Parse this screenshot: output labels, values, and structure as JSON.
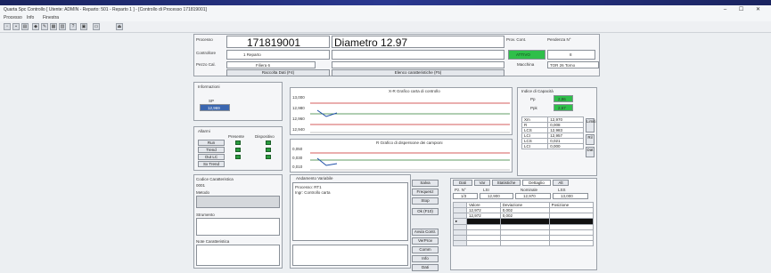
{
  "window": {
    "title": "Quarta Spc Controllo [ Utente: ADMIN - Reparto: 501 - Reparto 1 ] - [Controllo di Processo 171819001]",
    "controls": "– ☐ ✕"
  },
  "menu": [
    "Processo",
    "Info",
    "Finestra"
  ],
  "header": {
    "process_label": "Processo",
    "process_value": "171819001",
    "diameter": "Diametro 12.97",
    "controller_label": "Controllore",
    "controller_value": "1 Reparto",
    "part_label": "Pezzo Cal.",
    "part_value": "Filiera 6",
    "prov_label": "Prov. Cont.",
    "pending_label": "Pendenza N°",
    "pending_value": "8",
    "status_value": "ATTIVO",
    "machine_label": "Macchina",
    "machine_value": "TOR 26 Torno",
    "buttons": {
      "collect": "Raccolta Dati (F4)",
      "list": "Elenco caratteristiche (F5)"
    }
  },
  "info": {
    "title": "Informazioni",
    "sp_label": "SP",
    "sp_value": "12,969"
  },
  "alarms": {
    "title": "Allarmi",
    "col1": "Presente",
    "col2": "Dispositivo",
    "rows": [
      "Run",
      "Trend",
      "Out LC",
      "Sx Trend"
    ]
  },
  "char_control": {
    "title": "Codice Caratteristica",
    "code": "0001",
    "method_label": "Metodo",
    "notes_label": "Strumento",
    "char_notes_label": "Note Caratteristica"
  },
  "charts": [
    {
      "title": "X-R Grafico carta di controllo",
      "yticks": [
        "13,000",
        "12,980",
        "12,960",
        "12,940"
      ]
    },
    {
      "title": "R Grafico di dispersione dei campioni",
      "yticks": [
        "0,050",
        "0,030",
        "0,010"
      ]
    }
  ],
  "variable": {
    "title": "Andamento Variabile",
    "line1": "Processo: RT1",
    "line2": "Ingr: Controllo carta"
  },
  "side_buttons": [
    "Salva",
    "Frequenz",
    "Stop",
    "Ok (F10)",
    "Avvia Contr.",
    "VerProv",
    "Comm",
    "Info",
    "Dati"
  ],
  "capability": {
    "title": "Indice di Capacità",
    "pp_label": "Pp",
    "pp_value": "2,86",
    "ppk_label": "Ppk",
    "ppk_value": "2,67",
    "rows": [
      {
        "label": "Xm",
        "value": "12,970"
      },
      {
        "label": "R",
        "value": "0,008"
      },
      {
        "label": "LCS",
        "value": "12,983"
      },
      {
        "label": "LCI",
        "value": "12,957"
      },
      {
        "label": "LCS",
        "value": "0,021"
      },
      {
        "label": "LCI",
        "value": "0,000"
      }
    ],
    "tabs": [
      "Limiti",
      "Ril",
      "Dat"
    ]
  },
  "detail": {
    "tabs": [
      "Dati",
      "Var",
      "Statistiche",
      "Dettaglio",
      "Alt"
    ],
    "headers": [
      "Pz. N°",
      "LSI",
      "Nominale",
      "LSS"
    ],
    "values": [
      "1/3",
      "12,900",
      "12,970",
      "13,000"
    ],
    "table_headers": [
      "Valore",
      "Deviazione",
      "Posizione"
    ],
    "table_rows": [
      [
        "12,972",
        "0,002",
        ""
      ],
      [
        "12,972",
        "0,002",
        ""
      ]
    ]
  }
}
